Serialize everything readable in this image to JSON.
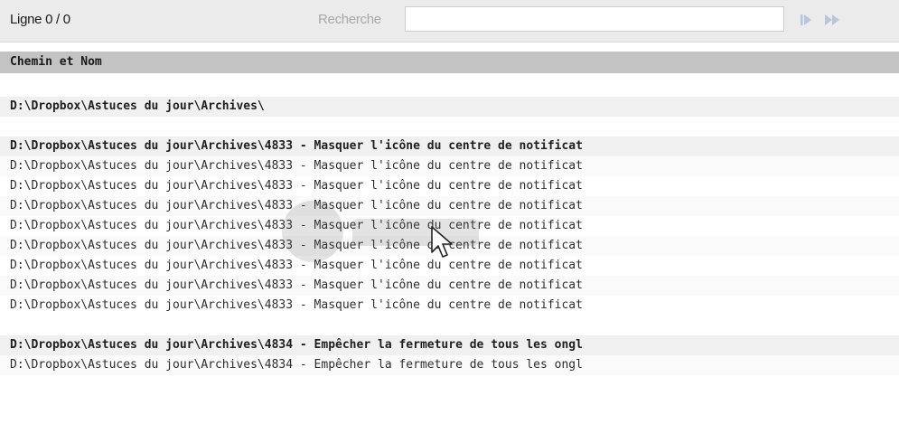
{
  "toolbar": {
    "line_counter": "Ligne 0 / 0",
    "search_label": "Recherche",
    "search_value": "",
    "next_icon": "play-next-icon",
    "last_icon": "fast-forward-icon"
  },
  "table": {
    "header": "Chemin et Nom",
    "rows": [
      "",
      "D:\\Dropbox\\Astuces du jour\\Archives\\",
      "",
      "D:\\Dropbox\\Astuces du jour\\Archives\\4833 - Masquer l'icône du centre de notificat",
      "D:\\Dropbox\\Astuces du jour\\Archives\\4833 - Masquer l'icône du centre de notificat",
      "D:\\Dropbox\\Astuces du jour\\Archives\\4833 - Masquer l'icône du centre de notificat",
      "D:\\Dropbox\\Astuces du jour\\Archives\\4833 - Masquer l'icône du centre de notificat",
      "D:\\Dropbox\\Astuces du jour\\Archives\\4833 - Masquer l'icône du centre de notificat",
      "D:\\Dropbox\\Astuces du jour\\Archives\\4833 - Masquer l'icône du centre de notificat",
      "D:\\Dropbox\\Astuces du jour\\Archives\\4833 - Masquer l'icône du centre de notificat",
      "D:\\Dropbox\\Astuces du jour\\Archives\\4833 - Masquer l'icône du centre de notificat",
      "D:\\Dropbox\\Astuces du jour\\Archives\\4833 - Masquer l'icône du centre de notificat",
      "",
      "D:\\Dropbox\\Astuces du jour\\Archives\\4834 - Empêcher la fermeture de tous les ongl",
      "D:\\Dropbox\\Astuces du jour\\Archives\\4834 - Empêcher la fermeture de tous les ongl"
    ],
    "group_rows": [
      1,
      3,
      13
    ]
  },
  "colors": {
    "toolbar_bg": "#ebebeb",
    "header_bg": "#c3c3c3",
    "group_row_bg": "#f0f0f0",
    "button_color": "#b9c4dd"
  }
}
